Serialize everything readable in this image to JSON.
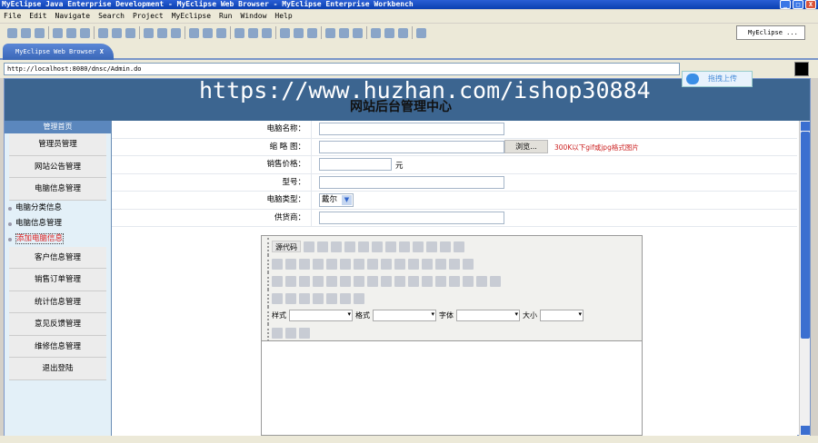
{
  "window": {
    "title": "MyEclipse Java Enterprise Development - MyEclipse Web Browser - MyEclipse Enterprise Workbench",
    "controls": [
      "_",
      "□",
      "X"
    ]
  },
  "menu": [
    "File",
    "Edit",
    "Navigate",
    "Search",
    "Project",
    "MyEclipse",
    "Run",
    "Window",
    "Help"
  ],
  "toolbar_icons": [
    "new-icon",
    "save-icon",
    "save-all-icon",
    "package-icon",
    "debug-icon",
    "lock-icon",
    "edit-icon",
    "edit2-icon",
    "deploy-icon",
    "server-icon",
    "globe-icon",
    "folder-icon",
    "refresh-icon",
    "terminal-icon",
    "tools-icon",
    "gear-icon",
    "run-icon",
    "search-icon",
    "bar-chart-icon",
    "grid-icon",
    "c-icon",
    "paint-icon",
    "brush-icon",
    "open-folder-icon",
    "nav-icon",
    "nav2-icon",
    "back-icon",
    "forward-icon"
  ],
  "perspective": "MyEclipse ...",
  "tab": {
    "label": "MyEclipse Web Browser",
    "close": "X"
  },
  "address": "http://localhost:8080/dnsc/Admin.do",
  "upload_label": "拖拽上传",
  "watermark": "https://www.huzhan.com/ishop30884",
  "banner_title": "网站后台管理中心",
  "sidebar": {
    "header": "管理首页",
    "items_top": [
      "管理员管理",
      "网站公告管理",
      "电脑信息管理"
    ],
    "subitems": [
      "电脑分类信息",
      "电脑信息管理",
      "添加电脑信息"
    ],
    "items_bottom": [
      "客户信息管理",
      "销售订单管理",
      "统计信息管理",
      "意见反馈管理",
      "维修信息管理",
      "退出登陆"
    ]
  },
  "form": {
    "name_label": "电脑名称：",
    "name_value": "",
    "thumb_label": "缩 略 图：",
    "thumb_value": "",
    "browse_label": "浏览...",
    "thumb_hint": "300K以下gif或jpg格式图片",
    "price_label": "销售价格：",
    "price_value": "",
    "price_unit": "元",
    "model_label": "型号：",
    "model_value": "",
    "type_label": "电脑类型：",
    "type_value": "戴尔",
    "supplier_label": "供货商：",
    "supplier_value": ""
  },
  "editor": {
    "source_label": "源代码",
    "style_label": "样式",
    "format_label": "格式",
    "font_label": "字体",
    "size_label": "大小",
    "row1": [
      "templates-icon",
      "save-icon",
      "new-page-icon",
      "preview-icon",
      "paste-word-icon",
      "cut-icon",
      "copy-icon",
      "paste-icon",
      "paste-text-icon",
      "paste-word2-icon",
      "print-icon",
      "spellcheck-icon"
    ],
    "row2": [
      "undo-icon",
      "redo-icon",
      "find-icon",
      "replace-icon",
      "select-all-icon",
      "remove-format-icon",
      "form-icon",
      "checkbox-icon",
      "radio-icon",
      "textfield-icon",
      "textarea-icon",
      "select-icon",
      "button-icon",
      "image-button-icon",
      "hidden-field-icon"
    ],
    "row3": [
      "bold-icon",
      "italic-icon",
      "underline-icon",
      "strike-icon",
      "subscript-icon",
      "superscript-icon",
      "ordered-list-icon",
      "unordered-list-icon",
      "outdent-icon",
      "indent-icon",
      "align-left-icon",
      "align-center-icon",
      "align-right-icon",
      "justify-icon",
      "link-icon",
      "unlink-icon",
      "anchor-icon"
    ],
    "row4": [
      "image-icon",
      "flash-icon",
      "table-icon",
      "hr-icon",
      "smiley-icon",
      "special-char-icon",
      "page-break-icon"
    ],
    "row6": [
      "text-color-icon",
      "bg-color-icon",
      "show-blocks-icon"
    ]
  }
}
